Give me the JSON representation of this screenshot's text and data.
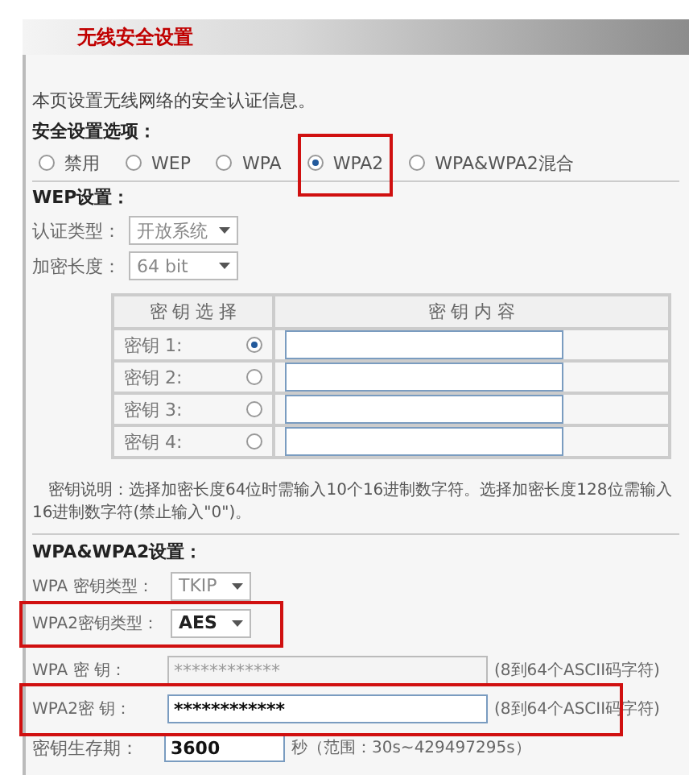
{
  "title": "无线安全设置",
  "intro": "本页设置无线网络的安全认证信息。",
  "options_heading": "安全设置选项：",
  "security_options": [
    {
      "label": "禁用",
      "selected": false,
      "highlighted": false
    },
    {
      "label": "WEP",
      "selected": false,
      "highlighted": false
    },
    {
      "label": "WPA",
      "selected": false,
      "highlighted": false
    },
    {
      "label": "WPA2",
      "selected": true,
      "highlighted": true
    },
    {
      "label": "WPA&WPA2混合",
      "selected": false,
      "highlighted": false
    }
  ],
  "wep": {
    "heading": "WEP设置：",
    "fields": [
      {
        "label": "认证类型：",
        "value": "开放系统"
      },
      {
        "label": "加密长度：",
        "value": "64 bit"
      }
    ],
    "table": {
      "columns": [
        "密 钥 选 择",
        "密 钥 内 容"
      ],
      "rows": [
        {
          "label": "密钥 1:",
          "selected": true
        },
        {
          "label": "密钥 2:",
          "selected": false
        },
        {
          "label": "密钥 3:",
          "selected": false
        },
        {
          "label": "密钥 4:",
          "selected": false
        }
      ]
    },
    "note": [
      "密钥说明：选择加密长度64位时需输入10个16进制数字符。选择加密长度128位需输入",
      "16进制数字符(禁止输入\"0\")。"
    ]
  },
  "wpa": {
    "heading": "WPA&WPA2设置：",
    "key_types": [
      {
        "label": "WPA 密钥类型：",
        "value": "TKIP",
        "disabled": true,
        "highlighted": false
      },
      {
        "label": "WPA2密钥类型：",
        "value": "AES",
        "disabled": false,
        "highlighted": true
      }
    ],
    "keys": [
      {
        "label": "WPA 密  钥：",
        "value": "************",
        "hint": "(8到64个ASCII码字符)",
        "disabled": true,
        "highlighted": false
      },
      {
        "label": "WPA2密  钥：",
        "value": "************",
        "hint": "(8到64个ASCII码字符)",
        "disabled": false,
        "highlighted": true
      }
    ],
    "lifetime": {
      "label": "密钥生存期：",
      "value": "3600",
      "hint": "秒（范围：30s~429497295s）"
    }
  }
}
